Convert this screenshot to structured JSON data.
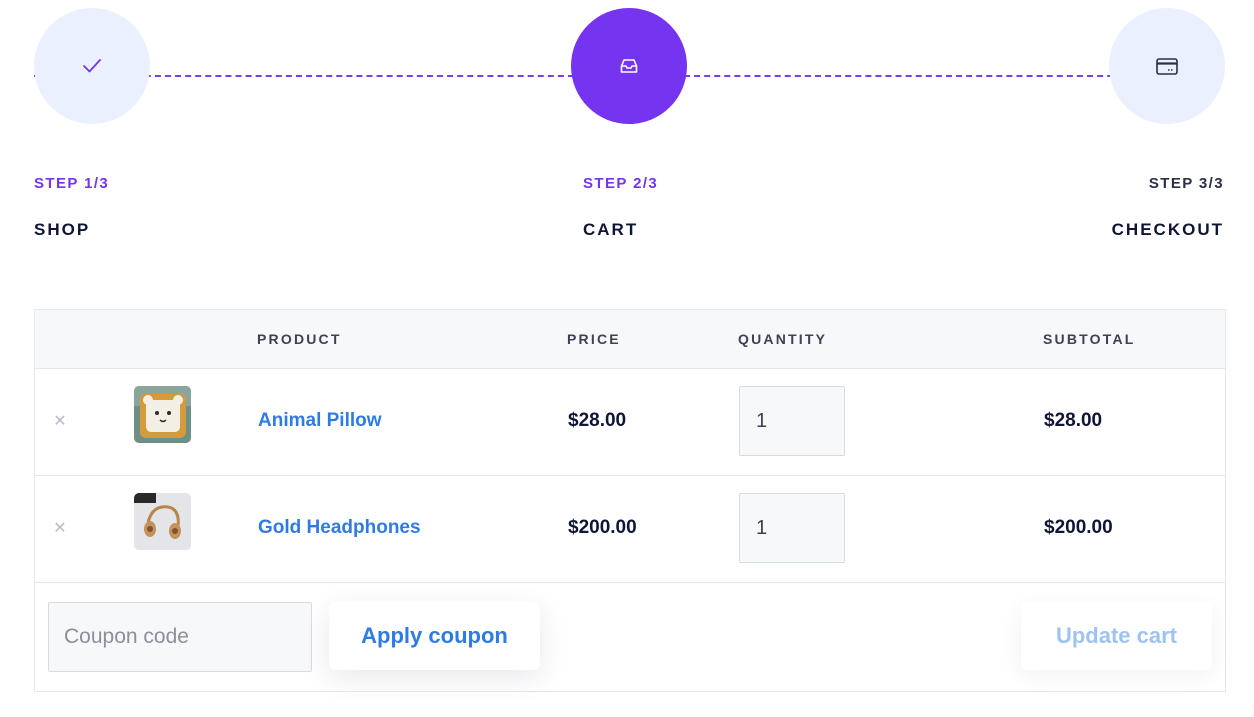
{
  "stepper": {
    "steps": [
      {
        "number": "STEP 1/3",
        "name": "SHOP",
        "state": "done",
        "icon": "check-icon"
      },
      {
        "number": "STEP 2/3",
        "name": "CART",
        "state": "active",
        "icon": "inbox-tray-icon"
      },
      {
        "number": "STEP 3/3",
        "name": "CHECKOUT",
        "state": "todo",
        "icon": "credit-card-icon"
      }
    ]
  },
  "cart": {
    "columns": [
      "PRODUCT",
      "PRICE",
      "QUANTITY",
      "SUBTOTAL"
    ],
    "items": [
      {
        "name": "Animal Pillow",
        "price": "$28.00",
        "quantity": "1",
        "subtotal": "$28.00",
        "thumbnail": "animal-pillow-image"
      },
      {
        "name": "Gold Headphones",
        "price": "$200.00",
        "quantity": "1",
        "subtotal": "$200.00",
        "thumbnail": "gold-headphones-image"
      }
    ],
    "remove_icon": "close-icon",
    "coupon_placeholder": "Coupon code",
    "apply_label": "Apply coupon",
    "update_label": "Update cart"
  },
  "colors": {
    "accent": "#7434f0",
    "link": "#2f7be6",
    "text": "#0f1535",
    "muted_button": "#9ec3f3"
  }
}
